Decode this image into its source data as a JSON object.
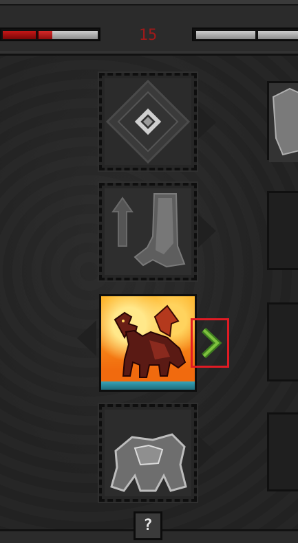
{
  "hud": {
    "counter": "15",
    "left_meter_fill": 0.45,
    "right_meter_fill": 1.0
  },
  "abilities": [
    {
      "name": "rune",
      "state": "locked"
    },
    {
      "name": "claw",
      "state": "locked"
    },
    {
      "name": "dragon",
      "state": "selected"
    },
    {
      "name": "golem",
      "state": "locked"
    }
  ],
  "help": {
    "label": "?"
  },
  "colors": {
    "accent_red": "#e01b24",
    "chevron_green": "#58a82a",
    "counter_red": "#9e1a1a"
  }
}
